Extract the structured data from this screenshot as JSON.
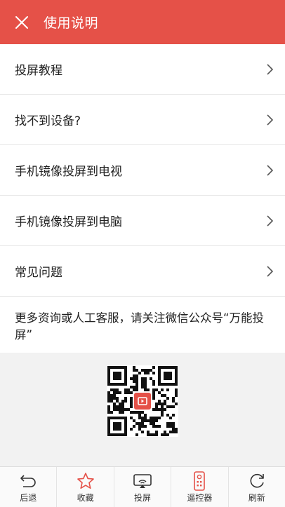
{
  "header": {
    "title": "使用说明",
    "close_icon": "close-icon"
  },
  "menu": [
    {
      "label": "投屏教程"
    },
    {
      "label": "找不到设备?"
    },
    {
      "label": "手机镜像投屏到电视"
    },
    {
      "label": "手机镜像投屏到电脑"
    },
    {
      "label": "常见问题"
    }
  ],
  "notice": "更多资询或人工客服，请关注微信公众号“万能投屏”",
  "qr": {
    "center_icon": "tv-logo-icon",
    "accent": "#e55148"
  },
  "tabbar": [
    {
      "label": "后退",
      "icon": "back-icon"
    },
    {
      "label": "收藏",
      "icon": "star-icon"
    },
    {
      "label": "投屏",
      "icon": "cast-icon"
    },
    {
      "label": "遥控器",
      "icon": "remote-icon"
    },
    {
      "label": "刷新",
      "icon": "refresh-icon"
    }
  ],
  "colors": {
    "header_bg": "#e55148",
    "qr_bg": "#f2f2f2",
    "icon_red": "#e55148"
  }
}
